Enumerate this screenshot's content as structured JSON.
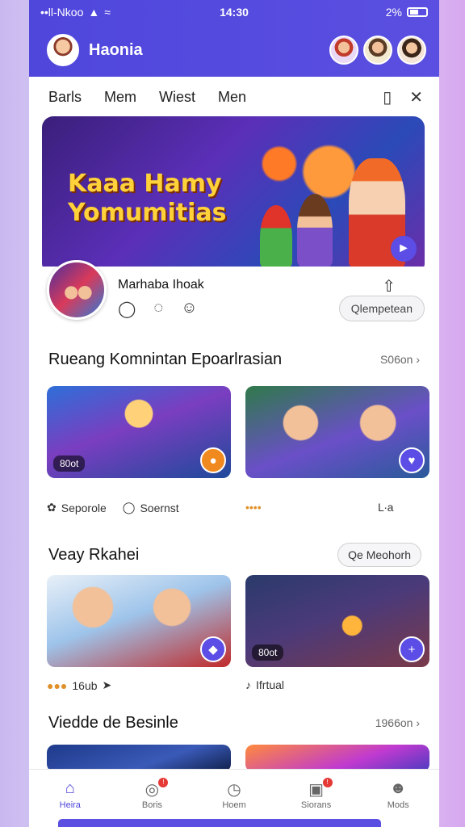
{
  "status": {
    "carrier": "••ll-Nkoo",
    "time": "14:30",
    "battery": "2%"
  },
  "app": {
    "title": "Haonia"
  },
  "tabs": [
    "Barls",
    "Mem",
    "Wiest",
    "Men"
  ],
  "banner": {
    "title_line1": "Kaaa Hamy",
    "title_line2": "Yomumitias"
  },
  "profile": {
    "name": "Marhaba Ihoak",
    "action_pill": "Qlempetean"
  },
  "sections": [
    {
      "title": "Rueang Komnintan Epoarlrasian",
      "more": "S06on ›"
    },
    {
      "title": "Veay Rkahei",
      "button": "Qe Meohorh"
    },
    {
      "title": "Viedde de Besinle",
      "more": "1966on ›"
    }
  ],
  "cards": [
    {
      "tag": "80ot",
      "meta": "Seporole",
      "meta2": "Soernst"
    },
    {
      "tag": "",
      "meta": "••••",
      "meta2": "L∙a"
    },
    {
      "tag": "",
      "meta": "16ub",
      "meta2": ""
    },
    {
      "tag": "80ot",
      "meta": "Ifrtual",
      "meta2": ""
    }
  ],
  "nav": [
    {
      "label": "Heira",
      "icon": "home-icon"
    },
    {
      "label": "Boris",
      "icon": "chat-icon"
    },
    {
      "label": "Hoem",
      "icon": "clock-icon"
    },
    {
      "label": "Siorans",
      "icon": "gallery-icon"
    },
    {
      "label": "Mods",
      "icon": "profile-icon"
    }
  ],
  "colors": {
    "primary": "#4f46dc",
    "accent": "#ffd23a",
    "badge": "#e53935"
  }
}
